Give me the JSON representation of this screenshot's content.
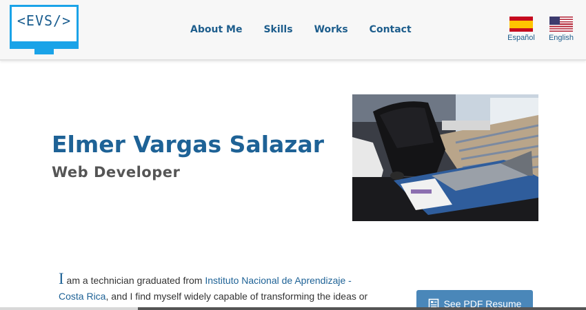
{
  "logo": {
    "text": "<EVS/>",
    "icon": "monitor-logo-icon"
  },
  "nav": [
    {
      "label": "About Me"
    },
    {
      "label": "Skills"
    },
    {
      "label": "Works"
    },
    {
      "label": "Contact"
    }
  ],
  "languages": [
    {
      "label": "Español",
      "icon": "spain-flag-icon"
    },
    {
      "label": "English",
      "icon": "us-flag-icon"
    }
  ],
  "hero": {
    "name": "Elmer Vargas Salazar",
    "role": "Web Developer",
    "photo": "desk-workspace-photo"
  },
  "intro": {
    "dropcap": "I",
    "text_before": " am a technician graduated from ",
    "link": "Instituto Nacional de Aprendizaje - Costa Rica",
    "text_after": ", and I find myself widely capable of transforming the ideas or"
  },
  "resume_button": {
    "label": "See PDF Resume",
    "icon": "document-icon"
  },
  "colors": {
    "accent": "#1e6296",
    "logo_blue": "#1aa3e8",
    "button": "#4a87b9"
  }
}
